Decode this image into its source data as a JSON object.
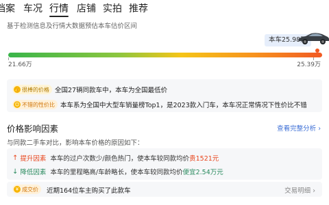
{
  "tabs": [
    {
      "label": "档案"
    },
    {
      "label": "车况"
    },
    {
      "label": "行情"
    },
    {
      "label": "店铺"
    },
    {
      "label": "实拍"
    },
    {
      "label": "推荐"
    }
  ],
  "active_tab": "行情",
  "subtitle": "基于检测信息及行情大数据预估本车估价区间",
  "price": {
    "car_badge": "本车25.98万",
    "range_low": "21.66万",
    "range_high": "25.39万",
    "position_fraction": 0.98
  },
  "highlights": [
    {
      "tag": "很棒的价格",
      "text": "全国27辆同款车中，本车为全国最低价"
    },
    {
      "tag": "不错的性价比",
      "text": "本车系为全国中大型车销量榜Top1，是2023款入门车，本车况正常情况下性价比不错"
    }
  ],
  "factors": {
    "title": "价格影响因素",
    "link": "查看完整分析",
    "desc": "与同款二手车对比，影响本车价格的原因如下：",
    "items": [
      {
        "label": "提升因素",
        "text": "本车的过户次数少/颜色热门，使本车较同款均价",
        "highlight": "贵1521元",
        "type": "up"
      },
      {
        "label": "降低因素",
        "text": "本车的里程略高/车龄略长，使本车较同款均价",
        "highlight": "便宜2.54万元",
        "type": "down"
      }
    ]
  },
  "deal": {
    "tag": "成交价",
    "text": "近期164位车主购买了此款车",
    "link": "交易明细"
  },
  "colors": {
    "link": "#3d6fd6",
    "up": "#e8441b",
    "down": "#2a8a5e",
    "tag_bg": "#fff1d9"
  }
}
